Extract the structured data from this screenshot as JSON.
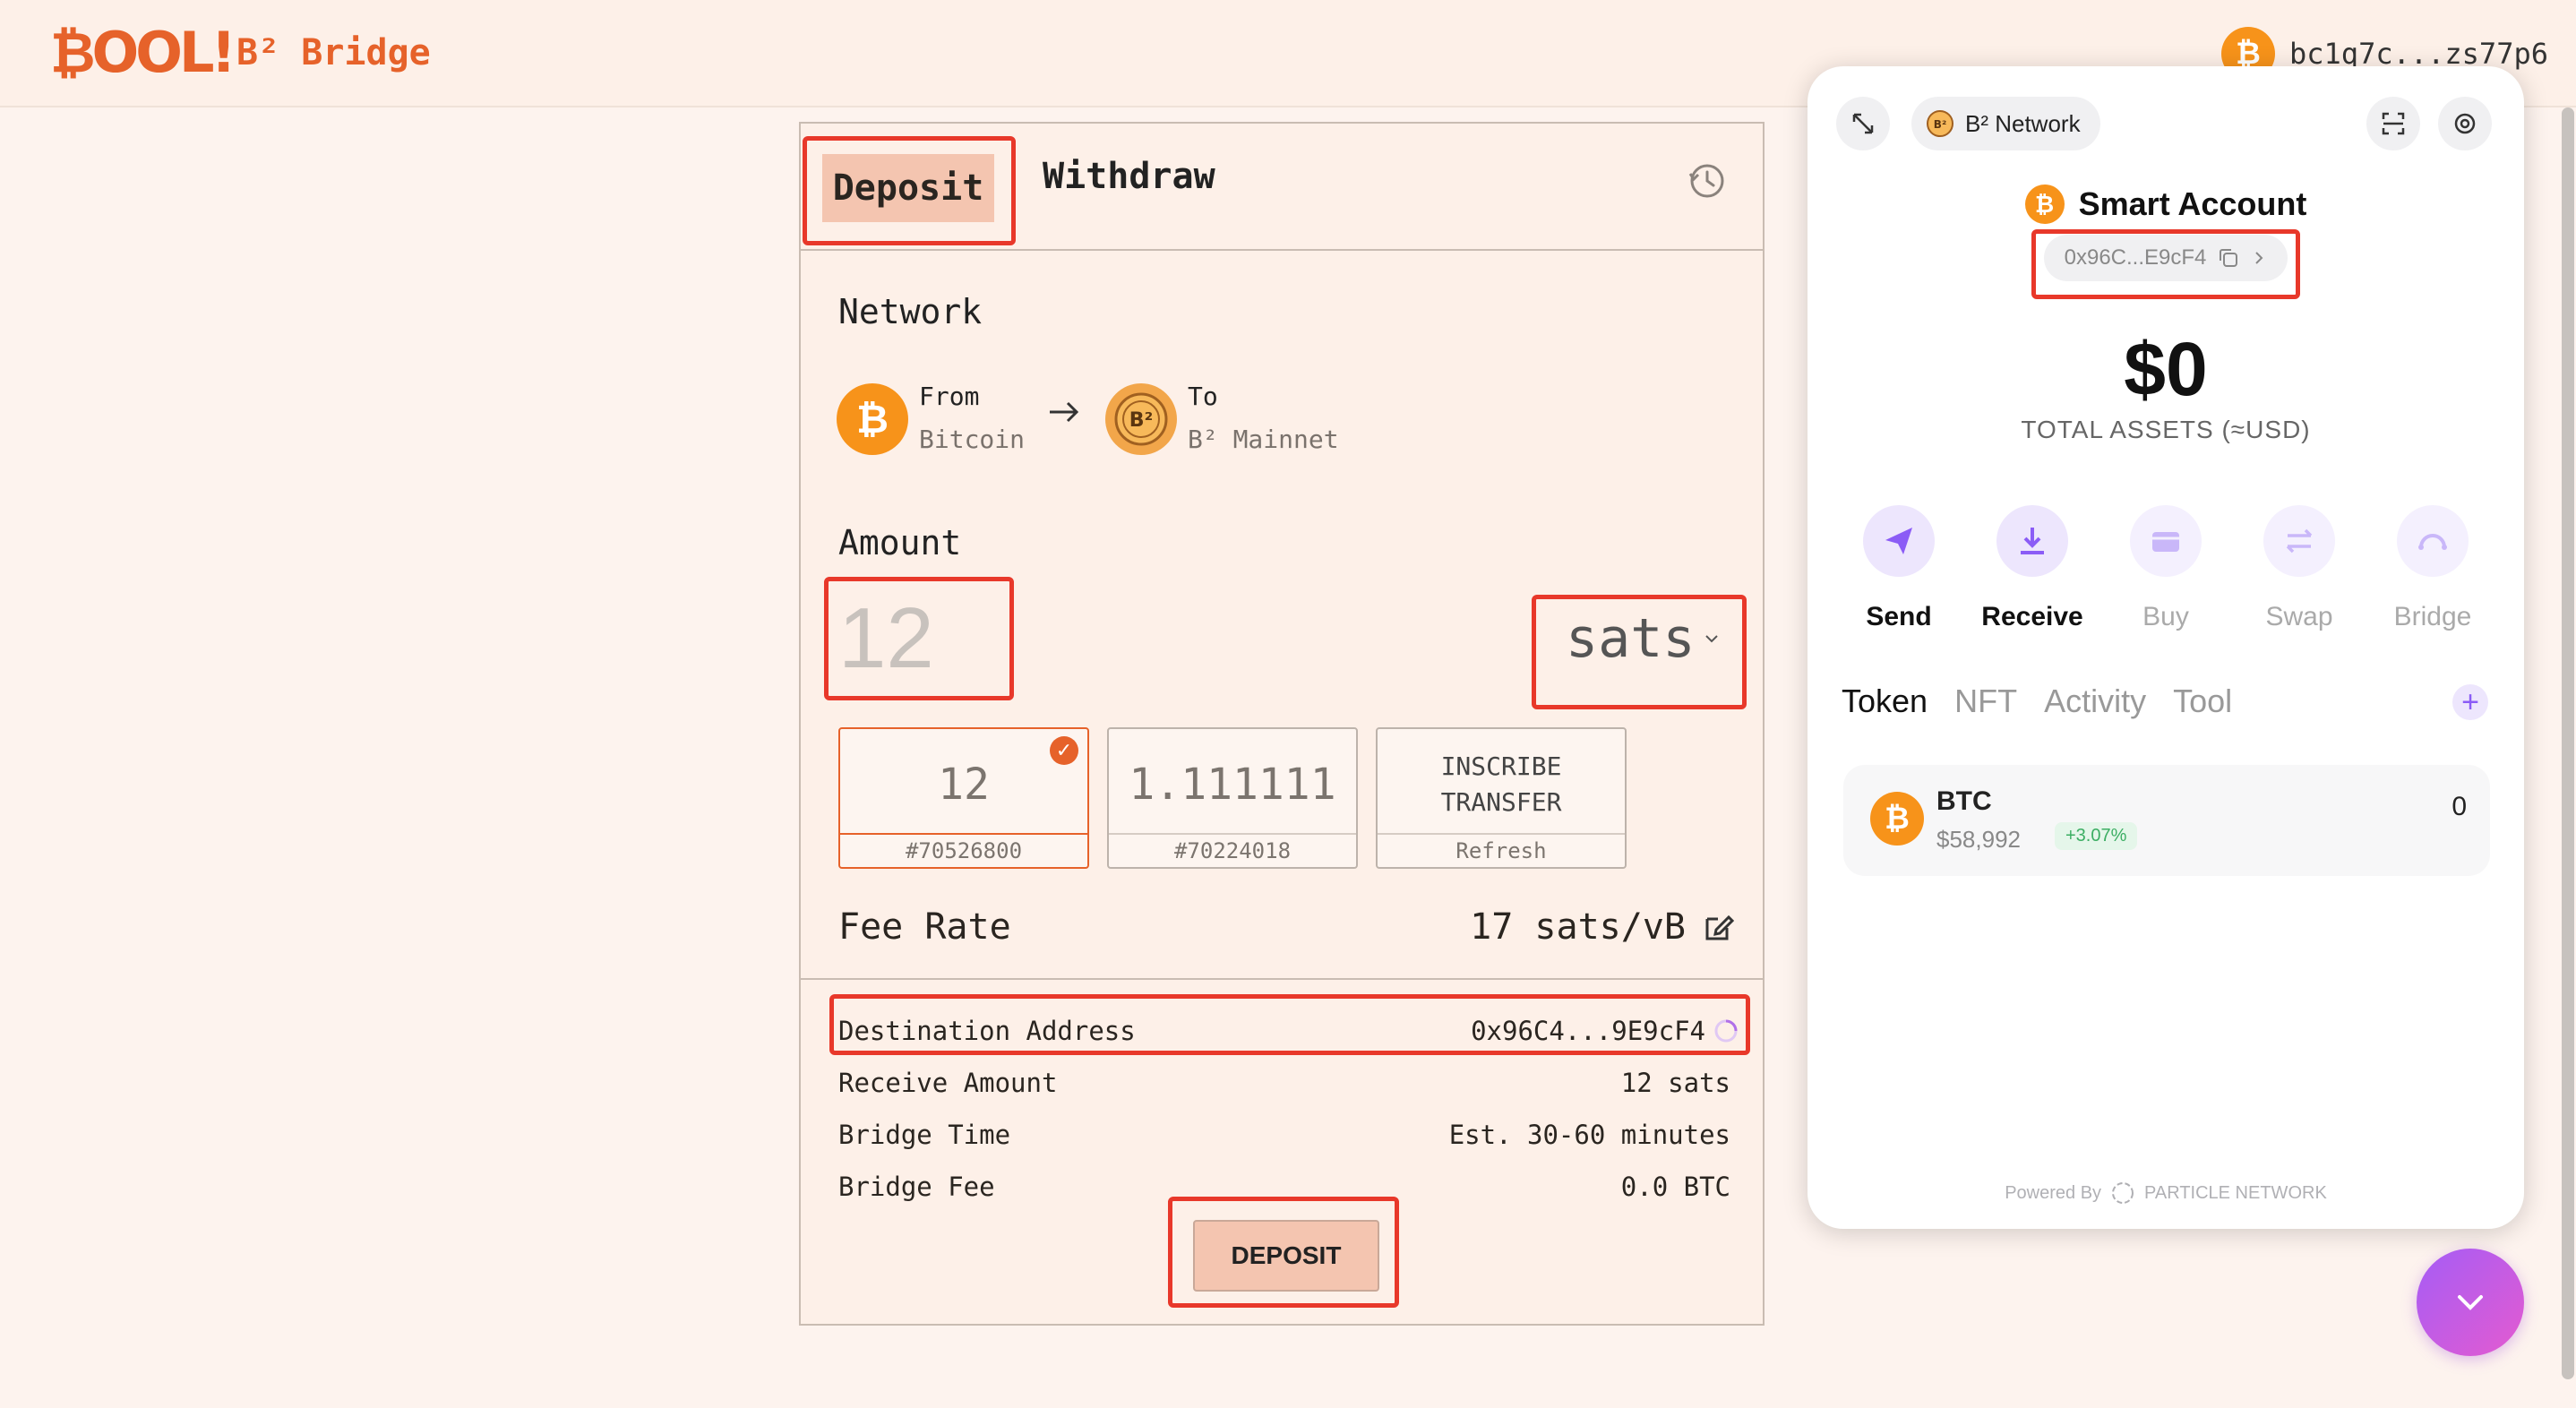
{
  "header": {
    "logo_text": "BOOL",
    "bridge_title": "B² Bridge",
    "wallet_address": "bc1q7c...zs77p6"
  },
  "bridge": {
    "tabs": [
      "Deposit",
      "Withdraw"
    ],
    "network": {
      "title": "Network",
      "from_label": "From",
      "from_value": "Bitcoin",
      "to_label": "To",
      "to_value": "B² Mainnet"
    },
    "amount": {
      "title": "Amount",
      "placeholder": "12",
      "unit": "sats"
    },
    "utxos": [
      {
        "value": "12",
        "id": "#70526800",
        "selected": true
      },
      {
        "value": "1.111111",
        "id": "#70224018",
        "selected": false
      },
      {
        "value": "INSCRIBE TRANSFER",
        "id": "Refresh",
        "selected": false
      }
    ],
    "fee": {
      "label": "Fee Rate",
      "value": "17 sats/vB"
    },
    "details": [
      {
        "label": "Destination Address",
        "value": "0x96C4...9E9cF4"
      },
      {
        "label": "Receive Amount",
        "value": "12 sats"
      },
      {
        "label": "Bridge Time",
        "value": "Est. 30-60 minutes"
      },
      {
        "label": "Bridge Fee",
        "value": "0.0 BTC"
      }
    ],
    "deposit_button": "DEPOSIT"
  },
  "wallet_panel": {
    "network": "B² Network",
    "account_name": "Smart Account",
    "account_address": "0x96C...E9cF4",
    "balance": "$0",
    "balance_caption": "TOTAL ASSETS (≈USD)",
    "actions": [
      "Send",
      "Receive",
      "Buy",
      "Swap",
      "Bridge"
    ],
    "tabs": [
      "Token",
      "NFT",
      "Activity",
      "Tool"
    ],
    "tokens": [
      {
        "symbol": "BTC",
        "price": "$58,992",
        "change": "+3.07%",
        "balance": "0"
      }
    ],
    "powered_by": "Powered By",
    "powered_brand": "PARTICLE NETWORK"
  },
  "colors": {
    "accent": "#e6622a",
    "highlight": "#e8382a",
    "deposit_bg": "#f4c5b0",
    "purple": "#8b5cf6"
  }
}
